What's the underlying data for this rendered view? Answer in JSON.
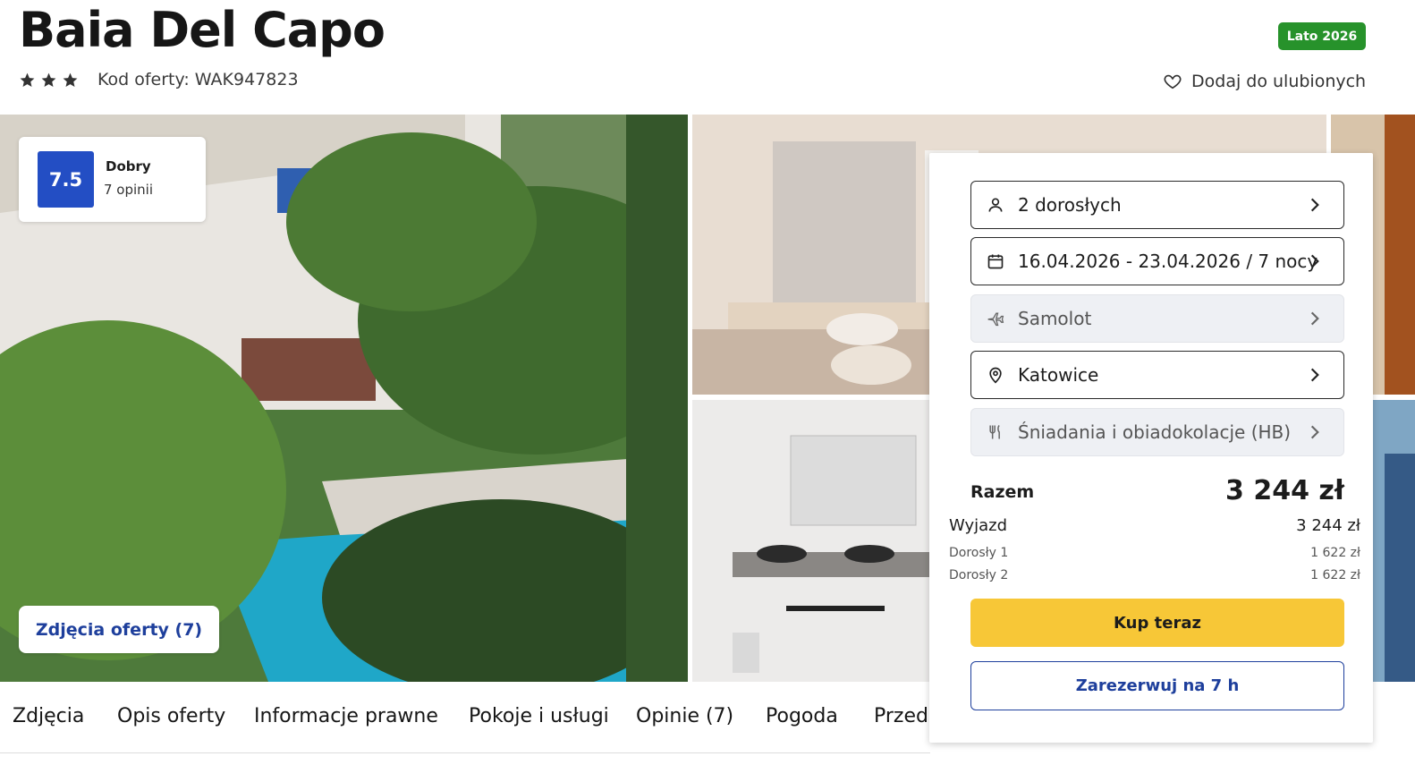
{
  "hotel": {
    "name": "Baia Del Capo",
    "season_badge": "Lato 2026",
    "stars": 3,
    "offer_code": "Kod oferty: WAK947823",
    "favorite_label": "Dodaj do ulubionych"
  },
  "rating": {
    "score": "7.5",
    "label": "Dobry",
    "count": "7 opinii"
  },
  "gallery": {
    "photos_button": "Zdjęcia oferty (7)"
  },
  "tabs": [
    "Zdjęcia",
    "Opis oferty",
    "Informacje prawne",
    "Pokoje i usługi",
    "Opinie (7)",
    "Pogoda",
    "Przed"
  ],
  "booking": {
    "travelers": "2 dorosłych",
    "dates": "16.04.2026 - 23.04.2026 / 7 nocy",
    "transport": "Samolot",
    "departure_city": "Katowice",
    "board": "Śniadania i obiadokolacje (HB)",
    "total_label": "Razem",
    "total_value": "3 244 zł",
    "departure_label": "Wyjazd",
    "departure_value": "3 244 zł",
    "adults": [
      {
        "label": "Dorosły 1",
        "price": "1 622 zł"
      },
      {
        "label": "Dorosły 2",
        "price": "1 622 zł"
      }
    ],
    "buy_label": "Kup teraz",
    "reserve_label": "Zarezerwuj na 7 h"
  },
  "colors": {
    "season_badge": "#27922b",
    "score_badge": "#234ec4",
    "buy_button": "#f7c737",
    "link_blue": "#1e3f9c"
  }
}
